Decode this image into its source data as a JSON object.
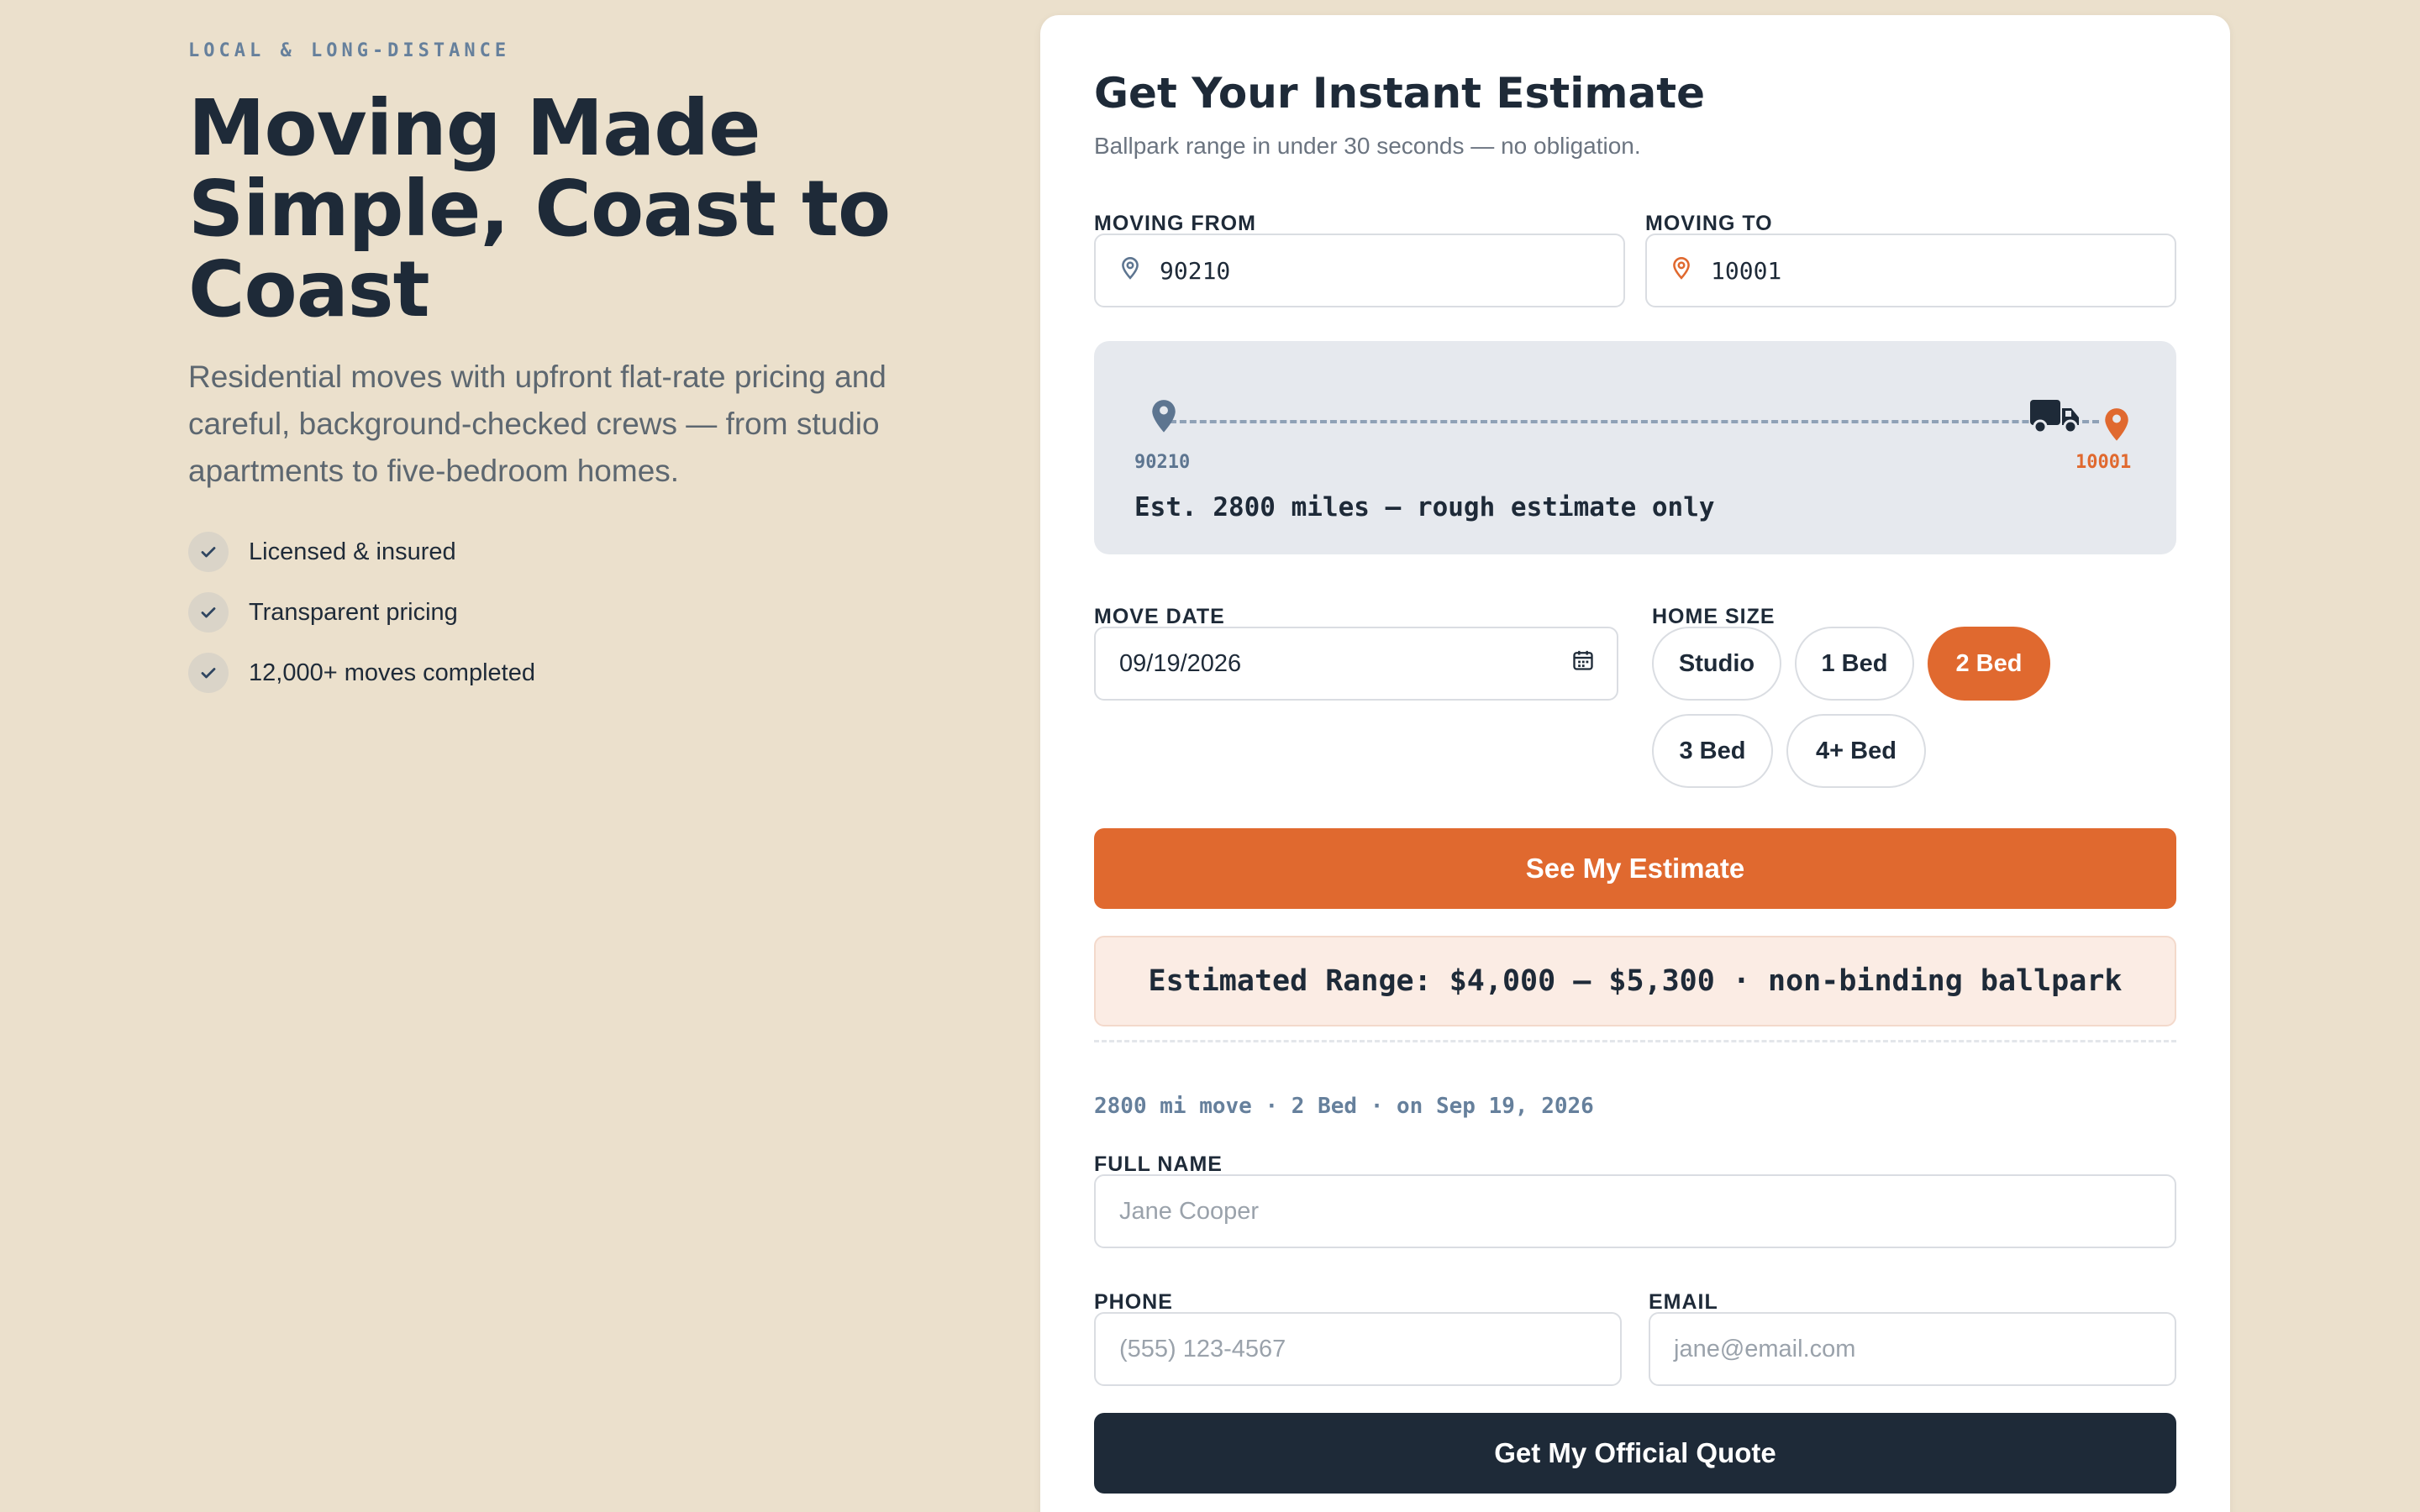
{
  "hero": {
    "eyebrow": "LOCAL & LONG-DISTANCE",
    "title": "Moving Made Simple, Coast to Coast",
    "subtitle": "Residential moves with upfront flat-rate pricing and careful, background-checked crews — from studio apartments to five-bedroom homes.",
    "benefits": [
      "Licensed & insured",
      "Transparent pricing",
      "12,000+ moves completed"
    ]
  },
  "form": {
    "title": "Get Your Instant Estimate",
    "subtitle": "Ballpark range in under 30 seconds — no obligation.",
    "from_label": "MOVING FROM",
    "from_value": "90210",
    "to_label": "MOVING TO",
    "to_value": "10001",
    "route": {
      "origin": "90210",
      "destination": "10001",
      "estimate_text": "Est. 2800 miles — rough estimate only"
    },
    "date_label": "MOVE DATE",
    "date_value": "09/19/2026",
    "size_label": "HOME SIZE",
    "sizes": [
      "Studio",
      "1 Bed",
      "2 Bed",
      "3 Bed",
      "4+ Bed"
    ],
    "selected_size": "2 Bed",
    "estimate_button": "See My Estimate",
    "range_text": "Estimated Range: $4,000 – $5,300 · non-binding ballpark",
    "summary_text": "2800 mi move · 2 Bed · on Sep 19, 2026",
    "name_label": "FULL NAME",
    "name_placeholder": "Jane Cooper",
    "phone_label": "PHONE",
    "phone_placeholder": "(555) 123-4567",
    "email_label": "EMAIL",
    "email_placeholder": "jane@email.com",
    "quote_button": "Get My Official Quote"
  },
  "colors": {
    "background": "#ebe0cc",
    "accent": "#e0692f",
    "navy": "#1e2a38",
    "slate": "#66809c"
  },
  "icons": [
    "check-icon",
    "map-pin-icon",
    "calendar-icon",
    "truck-icon"
  ]
}
